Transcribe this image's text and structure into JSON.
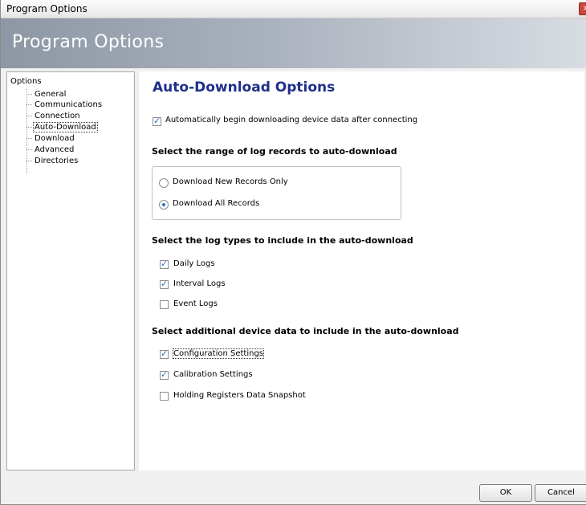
{
  "window": {
    "title": "Program Options",
    "close_glyph": "×"
  },
  "banner": {
    "title": "Program Options"
  },
  "tree": {
    "root": "Options",
    "items": [
      {
        "label": "General",
        "selected": false
      },
      {
        "label": "Communications",
        "selected": false
      },
      {
        "label": "Connection",
        "selected": false
      },
      {
        "label": "Auto-Download",
        "selected": true
      },
      {
        "label": "Download",
        "selected": false
      },
      {
        "label": "Advanced",
        "selected": false
      },
      {
        "label": "Directories",
        "selected": false
      }
    ]
  },
  "content": {
    "heading": "Auto-Download Options",
    "auto_begin": {
      "label": "Automatically begin downloading device data after connecting",
      "checked": true
    },
    "range_section": "Select the range of log records to auto-download",
    "range_options": [
      {
        "label": "Download New Records Only",
        "selected": false
      },
      {
        "label": "Download All Records",
        "selected": true
      }
    ],
    "log_section": "Select the log types to include in the auto-download",
    "log_types": [
      {
        "label": "Daily Logs",
        "checked": true
      },
      {
        "label": "Interval Logs",
        "checked": true
      },
      {
        "label": "Event Logs",
        "checked": false
      }
    ],
    "extra_section": "Select additional device data to include in the auto-download",
    "extra_data": [
      {
        "label": "Configuration Settings",
        "checked": true
      },
      {
        "label": "Calibration Settings",
        "checked": true
      },
      {
        "label": "Holding Registers Data Snapshot",
        "checked": false
      }
    ]
  },
  "buttons": {
    "ok": "OK",
    "cancel": "Cancel"
  },
  "colors": {
    "heading": "#1f2f8a",
    "check_accent": "#2a6fd0",
    "banner": "#a9b1bd"
  }
}
